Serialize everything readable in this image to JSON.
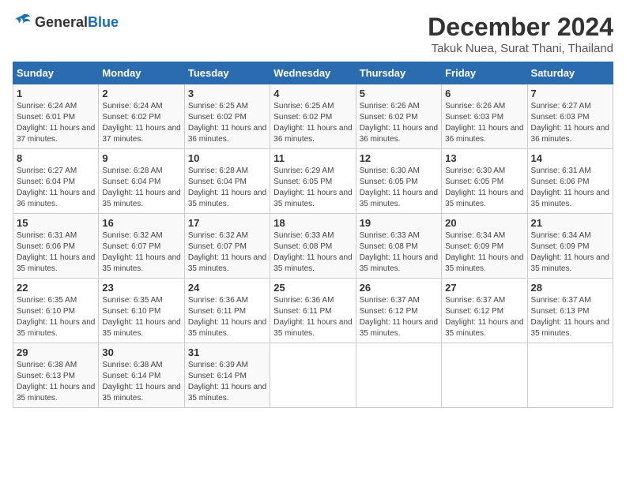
{
  "header": {
    "logo_general": "General",
    "logo_blue": "Blue",
    "title": "December 2024",
    "subtitle": "Takuk Nuea, Surat Thani, Thailand"
  },
  "calendar": {
    "days_of_week": [
      "Sunday",
      "Monday",
      "Tuesday",
      "Wednesday",
      "Thursday",
      "Friday",
      "Saturday"
    ],
    "weeks": [
      [
        {
          "day": "1",
          "sunrise": "6:24 AM",
          "sunset": "6:01 PM",
          "daylight": "11 hours and 37 minutes."
        },
        {
          "day": "2",
          "sunrise": "6:24 AM",
          "sunset": "6:02 PM",
          "daylight": "11 hours and 37 minutes."
        },
        {
          "day": "3",
          "sunrise": "6:25 AM",
          "sunset": "6:02 PM",
          "daylight": "11 hours and 36 minutes."
        },
        {
          "day": "4",
          "sunrise": "6:25 AM",
          "sunset": "6:02 PM",
          "daylight": "11 hours and 36 minutes."
        },
        {
          "day": "5",
          "sunrise": "6:26 AM",
          "sunset": "6:02 PM",
          "daylight": "11 hours and 36 minutes."
        },
        {
          "day": "6",
          "sunrise": "6:26 AM",
          "sunset": "6:03 PM",
          "daylight": "11 hours and 36 minutes."
        },
        {
          "day": "7",
          "sunrise": "6:27 AM",
          "sunset": "6:03 PM",
          "daylight": "11 hours and 36 minutes."
        }
      ],
      [
        {
          "day": "8",
          "sunrise": "6:27 AM",
          "sunset": "6:04 PM",
          "daylight": "11 hours and 36 minutes."
        },
        {
          "day": "9",
          "sunrise": "6:28 AM",
          "sunset": "6:04 PM",
          "daylight": "11 hours and 35 minutes."
        },
        {
          "day": "10",
          "sunrise": "6:28 AM",
          "sunset": "6:04 PM",
          "daylight": "11 hours and 35 minutes."
        },
        {
          "day": "11",
          "sunrise": "6:29 AM",
          "sunset": "6:05 PM",
          "daylight": "11 hours and 35 minutes."
        },
        {
          "day": "12",
          "sunrise": "6:30 AM",
          "sunset": "6:05 PM",
          "daylight": "11 hours and 35 minutes."
        },
        {
          "day": "13",
          "sunrise": "6:30 AM",
          "sunset": "6:05 PM",
          "daylight": "11 hours and 35 minutes."
        },
        {
          "day": "14",
          "sunrise": "6:31 AM",
          "sunset": "6:06 PM",
          "daylight": "11 hours and 35 minutes."
        }
      ],
      [
        {
          "day": "15",
          "sunrise": "6:31 AM",
          "sunset": "6:06 PM",
          "daylight": "11 hours and 35 minutes."
        },
        {
          "day": "16",
          "sunrise": "6:32 AM",
          "sunset": "6:07 PM",
          "daylight": "11 hours and 35 minutes."
        },
        {
          "day": "17",
          "sunrise": "6:32 AM",
          "sunset": "6:07 PM",
          "daylight": "11 hours and 35 minutes."
        },
        {
          "day": "18",
          "sunrise": "6:33 AM",
          "sunset": "6:08 PM",
          "daylight": "11 hours and 35 minutes."
        },
        {
          "day": "19",
          "sunrise": "6:33 AM",
          "sunset": "6:08 PM",
          "daylight": "11 hours and 35 minutes."
        },
        {
          "day": "20",
          "sunrise": "6:34 AM",
          "sunset": "6:09 PM",
          "daylight": "11 hours and 35 minutes."
        },
        {
          "day": "21",
          "sunrise": "6:34 AM",
          "sunset": "6:09 PM",
          "daylight": "11 hours and 35 minutes."
        }
      ],
      [
        {
          "day": "22",
          "sunrise": "6:35 AM",
          "sunset": "6:10 PM",
          "daylight": "11 hours and 35 minutes."
        },
        {
          "day": "23",
          "sunrise": "6:35 AM",
          "sunset": "6:10 PM",
          "daylight": "11 hours and 35 minutes."
        },
        {
          "day": "24",
          "sunrise": "6:36 AM",
          "sunset": "6:11 PM",
          "daylight": "11 hours and 35 minutes."
        },
        {
          "day": "25",
          "sunrise": "6:36 AM",
          "sunset": "6:11 PM",
          "daylight": "11 hours and 35 minutes."
        },
        {
          "day": "26",
          "sunrise": "6:37 AM",
          "sunset": "6:12 PM",
          "daylight": "11 hours and 35 minutes."
        },
        {
          "day": "27",
          "sunrise": "6:37 AM",
          "sunset": "6:12 PM",
          "daylight": "11 hours and 35 minutes."
        },
        {
          "day": "28",
          "sunrise": "6:37 AM",
          "sunset": "6:13 PM",
          "daylight": "11 hours and 35 minutes."
        }
      ],
      [
        {
          "day": "29",
          "sunrise": "6:38 AM",
          "sunset": "6:13 PM",
          "daylight": "11 hours and 35 minutes."
        },
        {
          "day": "30",
          "sunrise": "6:38 AM",
          "sunset": "6:14 PM",
          "daylight": "11 hours and 35 minutes."
        },
        {
          "day": "31",
          "sunrise": "6:39 AM",
          "sunset": "6:14 PM",
          "daylight": "11 hours and 35 minutes."
        },
        null,
        null,
        null,
        null
      ]
    ]
  }
}
